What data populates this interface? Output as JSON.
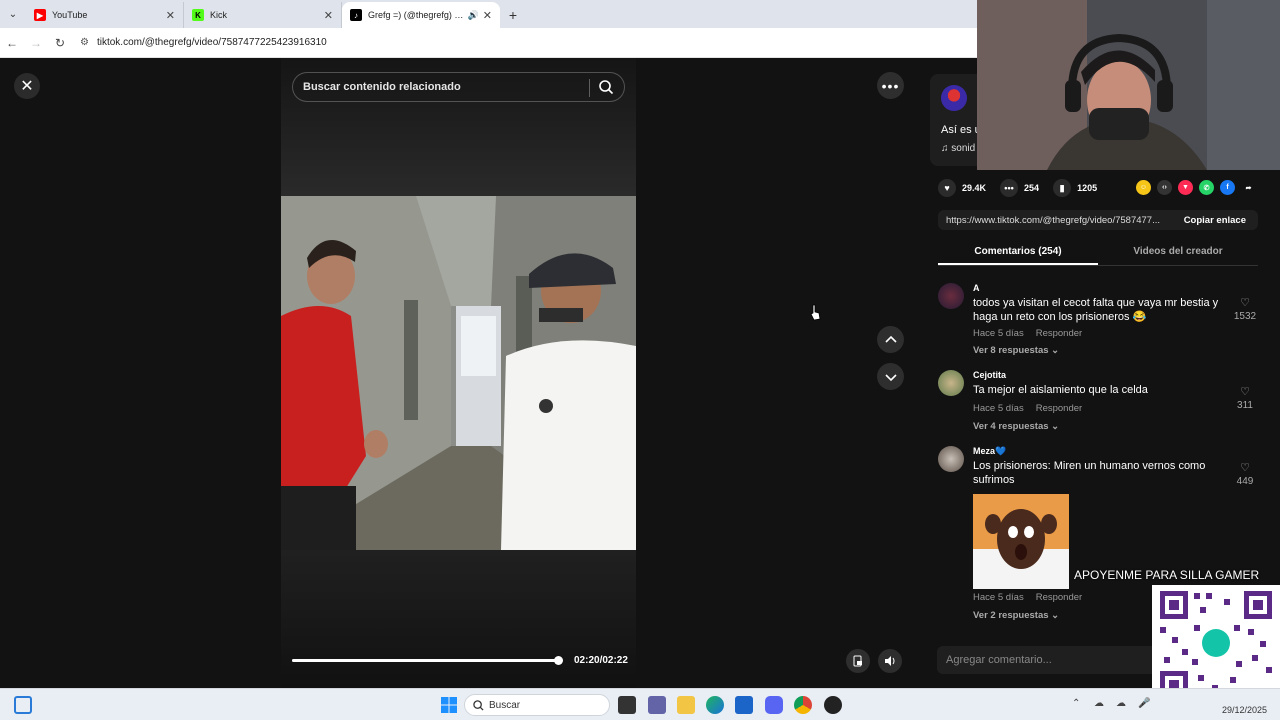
{
  "browser": {
    "tabs": [
      {
        "title": "YouTube",
        "favicon_color": "#ff0000",
        "active": false
      },
      {
        "title": "Kick",
        "favicon_color": "#53fc18",
        "active": false
      },
      {
        "title": "Grefg =) (@thegrefg) oficial",
        "favicon_color": "#000000",
        "active": true
      }
    ],
    "url": "tiktok.com/@thegrefg/video/7587477225423916310"
  },
  "video": {
    "search_placeholder": "Buscar contenido relacionado",
    "time": "02:20/02:22",
    "progress": 0.985
  },
  "panel": {
    "description": "Así es u",
    "music": "sonid",
    "stats": {
      "likes": "29.4K",
      "comments": "254",
      "saves": "1205"
    },
    "share_link": "https://www.tiktok.com/@thegrefg/video/7587477...",
    "copy_label": "Copiar enlace",
    "tabs": [
      "Comentarios (254)",
      "Videos del creador"
    ],
    "comments": [
      {
        "name": "A",
        "text": "todos ya visitan el cecot falta que vaya mr bestia y haga un reto con los prisioneros 😂",
        "time": "Hace 5 días",
        "reply": "Responder",
        "replies": "Ver 8 respuestas",
        "likes": "1532"
      },
      {
        "name": "Cejotita",
        "text": "Ta mejor el aislamiento que la celda",
        "time": "Hace 5 días",
        "reply": "Responder",
        "replies": "Ver 4 respuestas",
        "likes": "311"
      },
      {
        "name": "Meza💙",
        "text": "Los prisioneros: Miren un humano vernos como sufrimos",
        "time": "Hace 5 días",
        "reply": "Responder",
        "replies": "Ver 2 respuestas",
        "likes": "449"
      }
    ],
    "add_comment_placeholder": "Agregar comentario..."
  },
  "overlay": {
    "banner": "APOYENME PARA SILLA GAMER"
  },
  "taskbar": {
    "search_label": "Buscar",
    "date": "29/12/2025"
  },
  "colors": {
    "page_bg": "#121212",
    "accent_active_tab": "#ffffff",
    "youtube": "#ff0000",
    "kick": "#53fc18"
  }
}
